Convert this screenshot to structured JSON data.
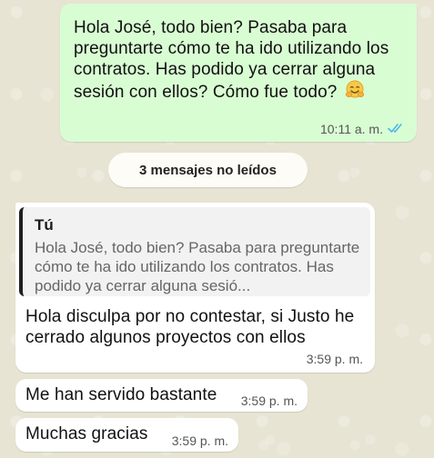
{
  "chat": {
    "outgoing": {
      "text": "Hola José, todo bien? Pasaba para preguntarte cómo te ha ido utilizando los contratos. Has podido ya cerrar alguna sesión con ellos? Cómo fue todo?",
      "emoji": "smiling-face-with-open-hands",
      "time": "10:11 a. m.",
      "status_icon": "double-check-read-icon",
      "status_color": "#4fb6ec"
    },
    "unread_banner": "3 mensajes no leídos",
    "reply": {
      "quoted_author": "Tú",
      "quoted_text": "Hola José, todo bien? Pasaba para preguntarte cómo te ha ido utilizando los contratos. Has podido ya cerrar alguna sesió...",
      "text": "Hola disculpa por no contestar, si Justo he cerrado algunos proyectos con ellos",
      "time": "3:59 p. m."
    },
    "messages": [
      {
        "text": "Me han servido bastante",
        "time": "3:59 p. m."
      },
      {
        "text": "Muchas gracias",
        "time": "3:59 p. m."
      }
    ]
  },
  "colors": {
    "wallpaper": "#e7e4d3",
    "outgoing_bubble": "#d9fdd3",
    "incoming_bubble": "#ffffff",
    "quote_bar": "#1f1f1f"
  }
}
